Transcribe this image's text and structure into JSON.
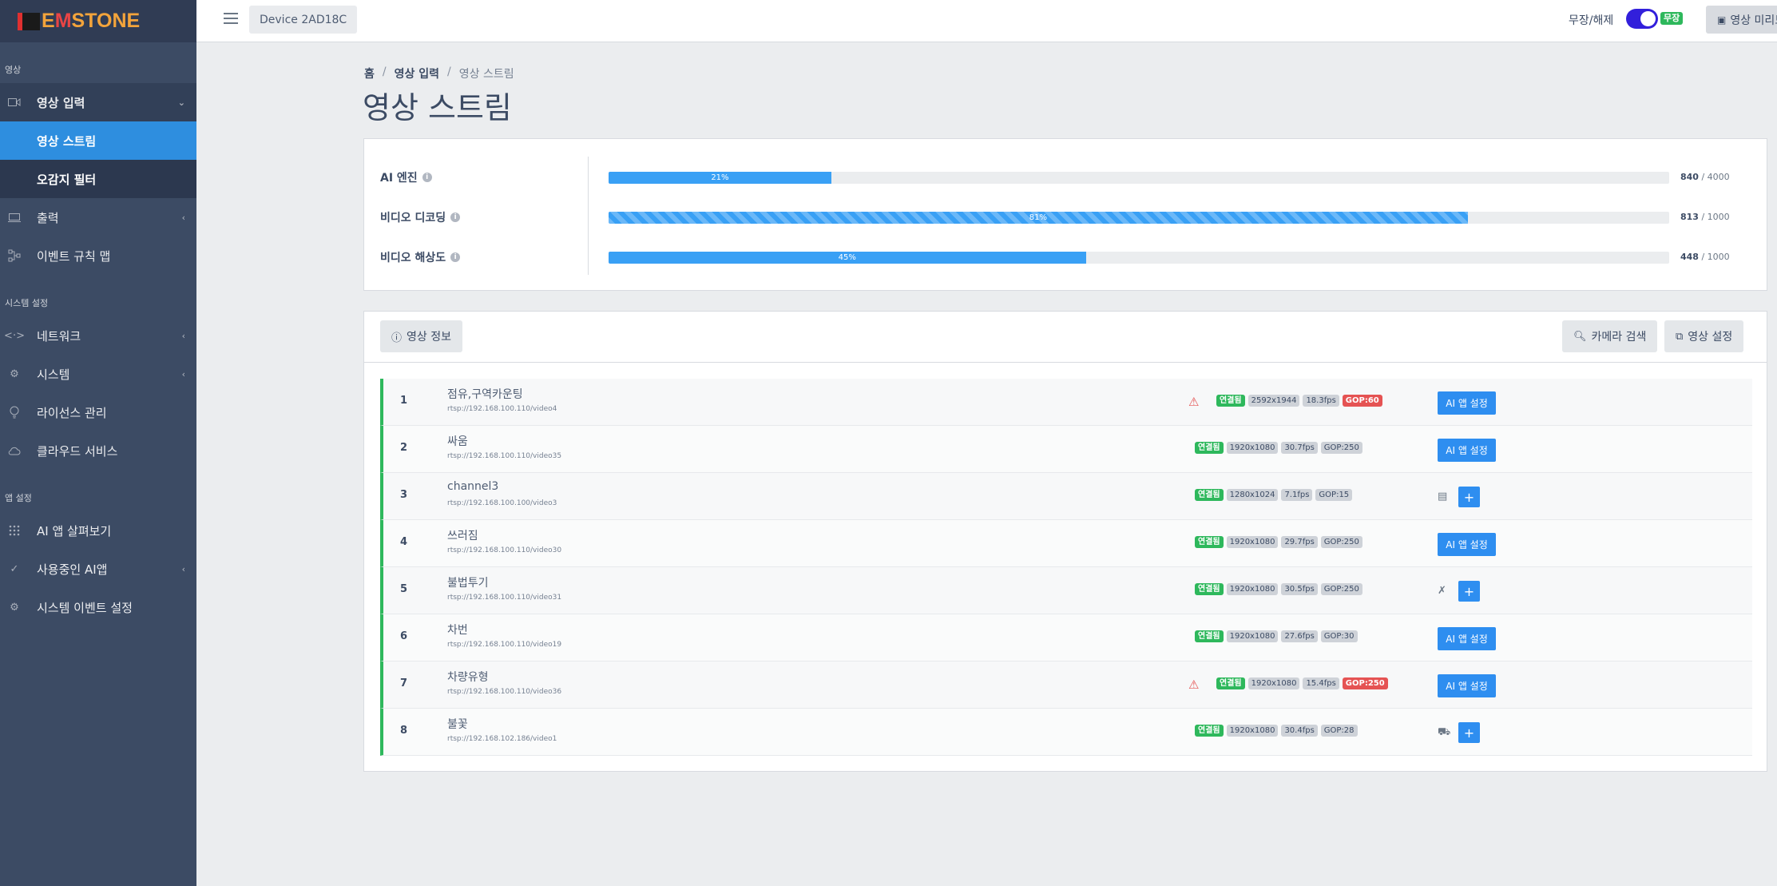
{
  "brand": {
    "text_a": "E",
    "text_m": "M",
    "text_b": "STONE"
  },
  "header": {
    "device": "Device 2AD18C",
    "arm_label": "무장/해제",
    "arm_badge": "무장",
    "preview_label": "영상 미리보기"
  },
  "sidebar": {
    "section_video": "영상",
    "video_input": "영상 입력",
    "video_stream": "영상 스트림",
    "false_alarm_filter": "오감지 필터",
    "output": "출력",
    "event_rule_map": "이벤트 규칙 맵",
    "section_system": "시스템 설정",
    "network": "네트워크",
    "system": "시스템",
    "license": "라이선스 관리",
    "cloud": "클라우드 서비스",
    "section_app": "앱 설정",
    "ai_app_browse": "AI 앱 살펴보기",
    "ai_app_in_use": "사용중인 AI앱",
    "system_event": "시스템 이벤트 설정"
  },
  "breadcrumb": {
    "home": "홈",
    "video_input": "영상 입력",
    "current": "영상 스트림"
  },
  "page_title": "영상 스트림",
  "resources": [
    {
      "label": "AI 엔진",
      "percent": 21,
      "percent_label": "21%",
      "used": "840",
      "max": "/ 4000",
      "striped": false
    },
    {
      "label": "비디오 디코딩",
      "percent": 81,
      "percent_label": "81%",
      "used": "813",
      "max": "/ 1000",
      "striped": true
    },
    {
      "label": "비디오 해상도",
      "percent": 45,
      "percent_label": "45%",
      "used": "448",
      "max": "/ 1000",
      "striped": false
    }
  ],
  "toolbar": {
    "video_info": "영상 정보",
    "camera_search": "카메라 검색",
    "video_settings": "영상 설정"
  },
  "streams": [
    {
      "idx": "1",
      "name": "점유,구역카운팅",
      "url": "rtsp://192.168.100.110/video4",
      "warning": true,
      "status": "연결됨",
      "resolution": "2592x1944",
      "fps": "18.3fps",
      "gop": "GOP:60",
      "gop_alert": true,
      "action": "AI 앱 설정"
    },
    {
      "idx": "2",
      "name": "싸움",
      "url": "rtsp://192.168.100.110/video35",
      "warning": false,
      "status": "연결됨",
      "resolution": "1920x1080",
      "fps": "30.7fps",
      "gop": "GOP:250",
      "gop_alert": false,
      "action": "AI 앱 설정"
    },
    {
      "idx": "3",
      "name": "channel3",
      "url": "rtsp://192.168.100.100/video3",
      "warning": false,
      "status": "연결됨",
      "resolution": "1280x1024",
      "fps": "7.1fps",
      "gop": "GOP:15",
      "gop_alert": false,
      "action": "",
      "app_icon": "license-plate-icon"
    },
    {
      "idx": "4",
      "name": "쓰러짐",
      "url": "rtsp://192.168.100.110/video30",
      "warning": false,
      "status": "연결됨",
      "resolution": "1920x1080",
      "fps": "29.7fps",
      "gop": "GOP:250",
      "gop_alert": false,
      "action": "AI 앱 설정"
    },
    {
      "idx": "5",
      "name": "불법투기",
      "url": "rtsp://192.168.100.110/video31",
      "warning": false,
      "status": "연결됨",
      "resolution": "1920x1080",
      "fps": "30.5fps",
      "gop": "GOP:250",
      "gop_alert": false,
      "action": "",
      "app_icon": "littering-icon"
    },
    {
      "idx": "6",
      "name": "차번",
      "url": "rtsp://192.168.100.110/video19",
      "warning": false,
      "status": "연결됨",
      "resolution": "1920x1080",
      "fps": "27.6fps",
      "gop": "GOP:30",
      "gop_alert": false,
      "action": "AI 앱 설정"
    },
    {
      "idx": "7",
      "name": "차량유형",
      "url": "rtsp://192.168.100.110/video36",
      "warning": true,
      "status": "연결됨",
      "resolution": "1920x1080",
      "fps": "15.4fps",
      "gop": "GOP:250",
      "gop_alert": true,
      "action": "AI 앱 설정"
    },
    {
      "idx": "8",
      "name": "불꽃",
      "url": "rtsp://192.168.102.186/video1",
      "warning": false,
      "status": "연결됨",
      "resolution": "1920x1080",
      "fps": "30.4fps",
      "gop": "GOP:28",
      "gop_alert": false,
      "action": "",
      "app_icon": "vehicle-icon"
    }
  ],
  "colors": {
    "accent": "#2e8ef0",
    "sidebar": "#3c4b64",
    "success": "#2eb85c",
    "danger": "#e55353"
  }
}
